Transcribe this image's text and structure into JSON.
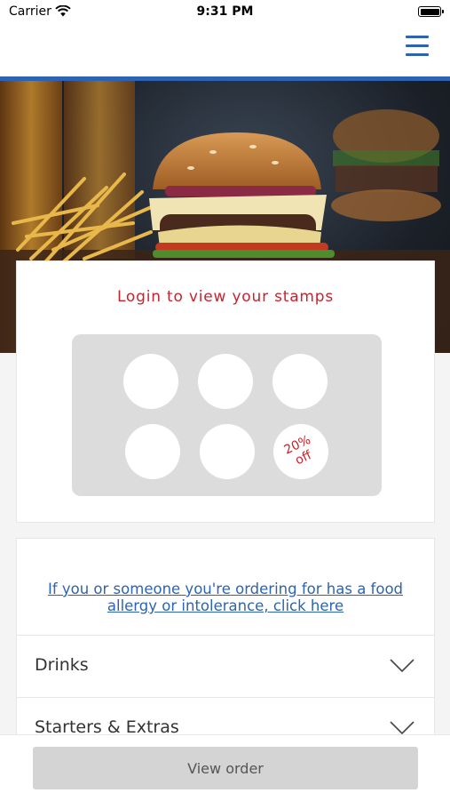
{
  "status_bar": {
    "carrier": "Carrier",
    "time": "9:31 PM"
  },
  "nav": {
    "menu_icon": "hamburger-menu-icon",
    "accent_color": "#2d63b3"
  },
  "hero": {
    "image": "burger-and-fries-photo"
  },
  "stamp_card": {
    "login_text": "Login to view your stamps",
    "reward_line1": "20%",
    "reward_line2": "off",
    "stamps_total": 6
  },
  "menu": {
    "allergy_link": "If you or someone you're ordering for has a food allergy or intolerance, click here",
    "categories": [
      {
        "label": "Drinks",
        "icon": "chevron-down-icon"
      },
      {
        "label": "Starters & Extras",
        "icon": "chevron-down-icon"
      }
    ]
  },
  "footer": {
    "view_order_label": "View order"
  },
  "colors": {
    "brand_red": "#c8232c",
    "brand_blue": "#2d63b3",
    "button_gray": "#d4d4d4"
  }
}
